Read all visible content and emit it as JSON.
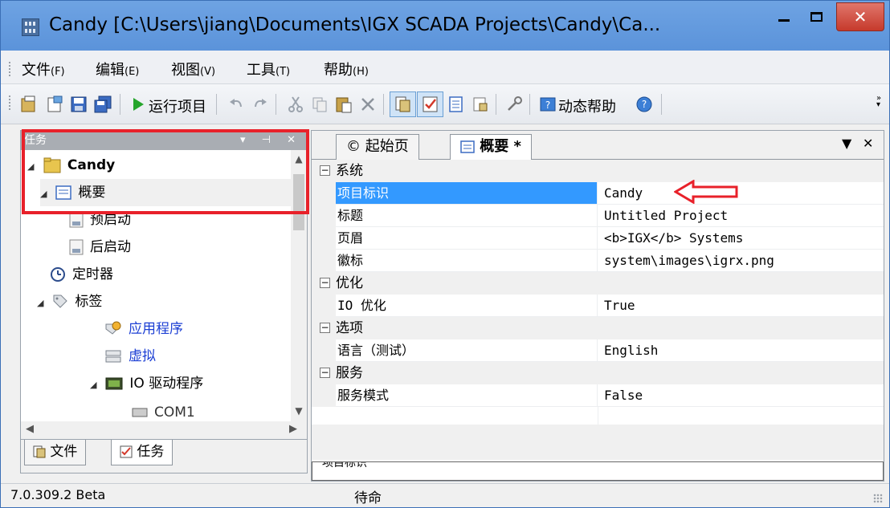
{
  "window": {
    "title": "Candy [C:\\Users\\jiang\\Documents\\IGX SCADA Projects\\Candy\\Ca...",
    "close_glyph": "✕"
  },
  "menu": [
    {
      "label": "文件",
      "key": "(F)"
    },
    {
      "label": "编辑",
      "key": "(E)"
    },
    {
      "label": "视图",
      "key": "(V)"
    },
    {
      "label": "工具",
      "key": "(T)"
    },
    {
      "label": "帮助",
      "key": "(H)"
    }
  ],
  "toolbar": {
    "run_label": "运行项目",
    "help_label": "动态帮助"
  },
  "left_pane": {
    "header": "任务",
    "header_controls": "▾ ⊣ ✕",
    "tree": [
      {
        "label": "Candy",
        "icon": "folder-icon"
      },
      {
        "label": "概要",
        "icon": "document-icon"
      },
      {
        "label": "预启动",
        "icon": "script-icon"
      },
      {
        "label": "后启动",
        "icon": "script-icon"
      },
      {
        "label": "定时器",
        "icon": "clock-icon"
      },
      {
        "label": "标签",
        "icon": "tag-icon"
      },
      {
        "label": "应用程序",
        "icon": "app-tags-icon"
      },
      {
        "label": "虚拟",
        "icon": "virtual-icon"
      },
      {
        "label": "IO 驱动程序",
        "icon": "io-driver-icon"
      }
    ],
    "partial_item": "COM1",
    "tabs": [
      "文件",
      "任务"
    ]
  },
  "right_pane": {
    "tabs": [
      "起始页",
      "概要 *"
    ],
    "categories": [
      {
        "name": "系统",
        "rows": [
          {
            "key": "项目标识",
            "value": "Candy"
          },
          {
            "key": "标题",
            "value": "Untitled Project"
          },
          {
            "key": "页眉",
            "value": "<b>IGX</b> Systems"
          },
          {
            "key": "徽标",
            "value": "system\\images\\igrx.png"
          }
        ]
      },
      {
        "name": "优化",
        "rows": [
          {
            "key": "IO 优化",
            "value": "True"
          }
        ]
      },
      {
        "name": "选项",
        "rows": [
          {
            "key": "语言（测试）",
            "value": "English"
          }
        ]
      },
      {
        "name": "服务",
        "rows": [
          {
            "key": "服务模式",
            "value": "False"
          }
        ]
      }
    ],
    "description_partial": "项目标识"
  },
  "statusbar": {
    "version": "7.0.309.2 Beta",
    "status": "待命"
  },
  "colors": {
    "selection": "#3399ff",
    "annotation": "#e8212a"
  }
}
